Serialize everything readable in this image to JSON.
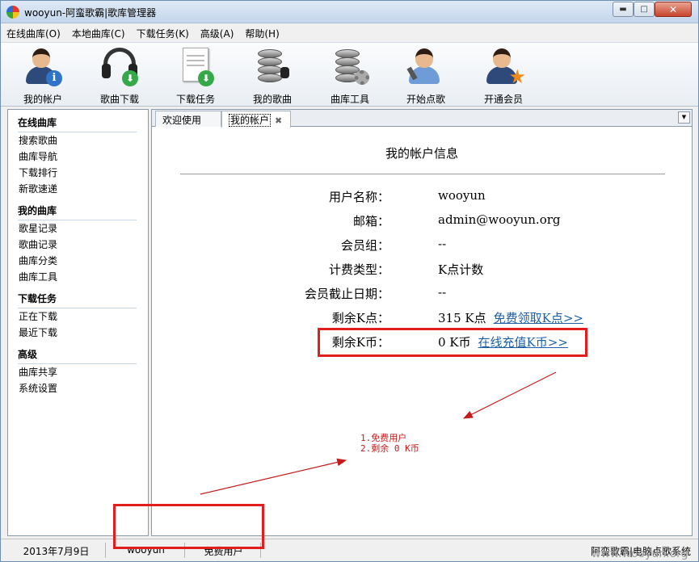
{
  "window": {
    "title": "wooyun-阿蛮歌霸|歌库管理器"
  },
  "menu": [
    "在线曲库(O)",
    "本地曲库(C)",
    "下载任务(K)",
    "高级(A)",
    "帮助(H)"
  ],
  "toolbar": [
    {
      "label": "我的帐户",
      "icon": "account-info-icon"
    },
    {
      "label": "歌曲下载",
      "icon": "headphone-download-icon"
    },
    {
      "label": "下载任务",
      "icon": "notepad-download-icon"
    },
    {
      "label": "我的歌曲",
      "icon": "database-headphone-icon"
    },
    {
      "label": "曲库工具",
      "icon": "database-gear-icon"
    },
    {
      "label": "开始点歌",
      "icon": "singer-mic-icon"
    },
    {
      "label": "开通会员",
      "icon": "member-star-icon"
    }
  ],
  "sidebar": {
    "groups": [
      {
        "title": "在线曲库",
        "items": [
          "搜索歌曲",
          "曲库导航",
          "下载排行",
          "新歌速递"
        ]
      },
      {
        "title": "我的曲库",
        "items": [
          "歌星记录",
          "歌曲记录",
          "曲库分类",
          "曲库工具"
        ]
      },
      {
        "title": "下载任务",
        "items": [
          "正在下载",
          "最近下载"
        ]
      },
      {
        "title": "高级",
        "items": [
          "曲库共享",
          "系统设置"
        ]
      }
    ]
  },
  "tabs": [
    {
      "label": "欢迎使用"
    },
    {
      "label": "我的帐户"
    }
  ],
  "account": {
    "title": "我的帐户信息",
    "rows": [
      {
        "label": "用户名称：",
        "value": "wooyun"
      },
      {
        "label": "邮箱：",
        "value": "admin@wooyun.org"
      },
      {
        "label": "会员组：",
        "value": "--"
      },
      {
        "label": "计费类型：",
        "value": "K点计数"
      },
      {
        "label": "会员截止日期：",
        "value": "--"
      },
      {
        "label": "剩余K点：",
        "value": "315 K点",
        "link": "免费领取K点>>"
      },
      {
        "label": "剩余K币：",
        "value": "0 K币",
        "link": "在线充值K币>>"
      }
    ]
  },
  "annotation": {
    "lines": [
      "1.免费用户",
      "2.剩余 0 K币"
    ],
    "color": "#e11e1e"
  },
  "status": {
    "date": "2013年7月9日",
    "user": "wooyun",
    "level": "免费用户",
    "app": "阿蛮歌霸|电脑点歌系统"
  },
  "watermark": "www.wooyun.org"
}
